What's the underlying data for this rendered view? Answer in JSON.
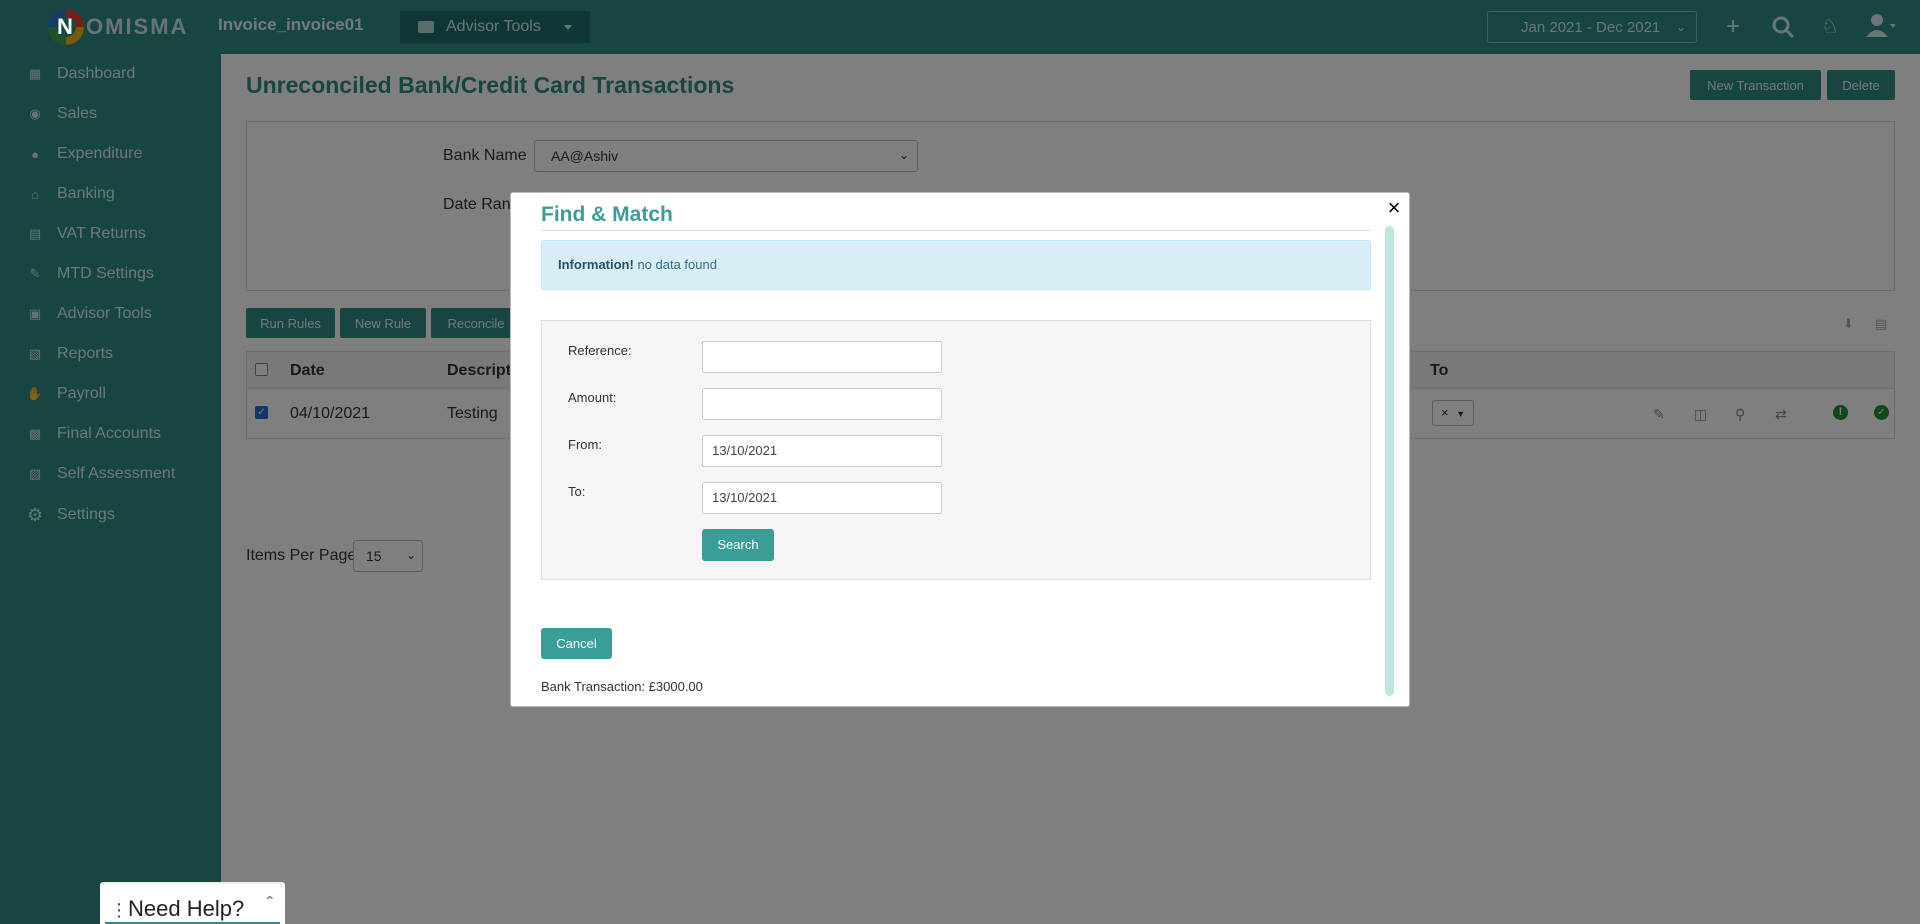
{
  "app": {
    "logo_text": "NOMISMA",
    "company": "Invoice_invoice01",
    "advisor_tools": "Advisor Tools",
    "period": "Jan 2021 - Dec 2021"
  },
  "icons": {
    "add": "plus-icon",
    "search": "search-icon",
    "crest": "crest-icon",
    "user": "user-icon"
  },
  "sidebar": {
    "items": [
      {
        "label": "Dashboard",
        "icon": "grid-icon"
      },
      {
        "label": "Sales",
        "icon": "tag-icon"
      },
      {
        "label": "Expenditure",
        "icon": "money-bag-icon"
      },
      {
        "label": "Banking",
        "icon": "bank-icon"
      },
      {
        "label": "VAT Returns",
        "icon": "vat-icon"
      },
      {
        "label": "MTD Settings",
        "icon": "pen-icon"
      },
      {
        "label": "Advisor Tools",
        "icon": "briefcase-icon"
      },
      {
        "label": "Reports",
        "icon": "report-icon"
      },
      {
        "label": "Payroll",
        "icon": "payroll-icon"
      },
      {
        "label": "Final Accounts",
        "icon": "accounts-icon"
      },
      {
        "label": "Self Assessment",
        "icon": "assessment-icon"
      },
      {
        "label": "Settings",
        "icon": "gear-icon"
      }
    ]
  },
  "page": {
    "title": "Unreconciled Bank/Credit Card Transactions",
    "new_transaction": "New Transaction",
    "delete": "Delete",
    "bank_name_label": "Bank Name",
    "bank_name_value": "AA@Ashiv",
    "date_range_label": "Date Range",
    "run_rules": "Run Rules",
    "new_rule": "New Rule",
    "reconcile": "Reconcile",
    "items_per_page_label": "Items Per Page",
    "items_per_page_value": "15"
  },
  "table": {
    "headers": {
      "date": "Date",
      "description": "Descripti",
      "to": "To"
    },
    "rows": [
      {
        "date": "04/10/2021",
        "description": "Testing",
        "to_clear": "×",
        "selected": true
      }
    ]
  },
  "modal": {
    "title": "Find & Match",
    "close": "×",
    "info_strong": "Information!",
    "info_text": " no data found",
    "reference_label": "Reference:",
    "reference_value": "",
    "amount_label": "Amount:",
    "amount_value": "",
    "from_label": "From:",
    "from_value": "13/10/2021",
    "to_label": "To:",
    "to_value": "13/10/2021",
    "search_button": "Search",
    "cancel_button": "Cancel",
    "bank_transaction": "Bank Transaction: £3000.00"
  },
  "help": {
    "label": "Need Help?"
  }
}
